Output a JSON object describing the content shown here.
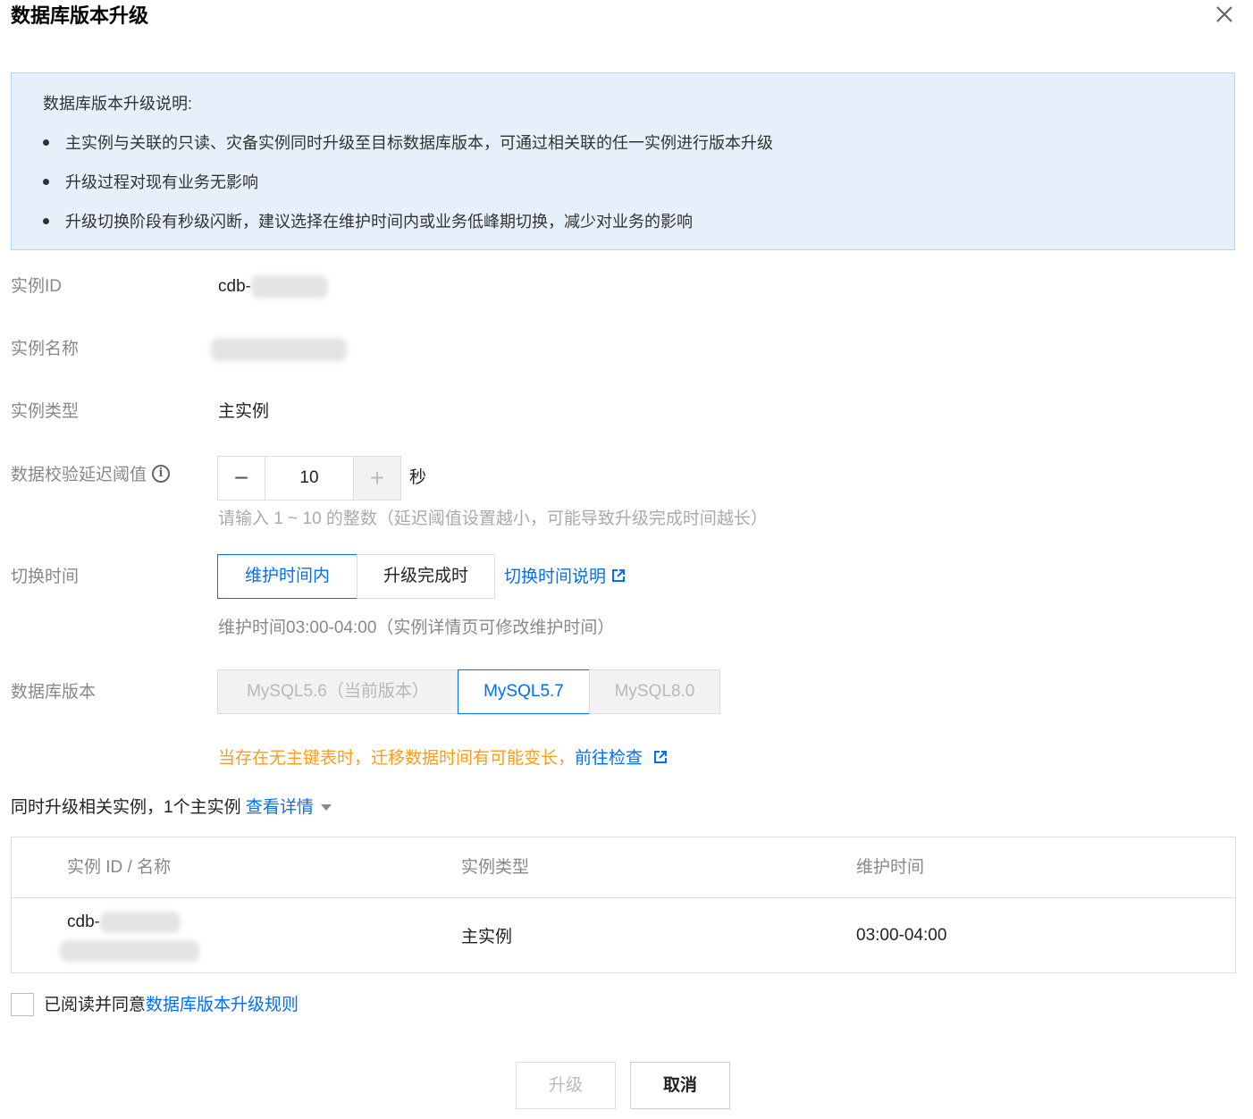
{
  "dialog": {
    "title": "数据库版本升级",
    "close_icon": "close-icon"
  },
  "notice": {
    "title": "数据库版本升级说明:",
    "items": [
      "主实例与关联的只读、灾备实例同时升级至目标数据库版本，可通过相关联的任一实例进行版本升级",
      "升级过程对现有业务无影响",
      "升级切换阶段有秒级闪断，建议选择在维护时间内或业务低峰期切换，减少对业务的影响"
    ]
  },
  "form": {
    "instance_id": {
      "label": "实例ID",
      "value_prefix": "cdb-"
    },
    "instance_name": {
      "label": "实例名称"
    },
    "instance_type": {
      "label": "实例类型",
      "value": "主实例"
    },
    "delay_threshold": {
      "label": "数据校验延迟阈值",
      "info_icon": "info-icon",
      "value": "10",
      "unit": "秒",
      "minus_icon": "minus-icon",
      "plus_icon": "plus-icon",
      "hint": "请输入 1 ~ 10 的整数（延迟阈值设置越小，可能导致升级完成时间越长）"
    },
    "switch_time": {
      "label": "切换时间",
      "options": [
        "维护时间内",
        "升级完成时"
      ],
      "selected": "维护时间内",
      "help_link": "切换时间说明",
      "hint": "维护时间03:00-04:00（实例详情页可修改维护时间）"
    },
    "db_version": {
      "label": "数据库版本",
      "options": [
        "MySQL5.6（当前版本）",
        "MySQL5.7",
        "MySQL8.0"
      ],
      "selected": "MySQL5.7"
    },
    "warning": {
      "text": "当存在无主键表时，迁移数据时间有可能变长，",
      "link": "前往检查"
    }
  },
  "related": {
    "text": "同时升级相关实例，1个主实例 ",
    "link": "查看详情",
    "table": {
      "headers": [
        "实例 ID / 名称",
        "实例类型",
        "维护时间"
      ],
      "rows": [
        {
          "id_prefix": "cdb-",
          "type": "主实例",
          "maintenance": "03:00-04:00"
        }
      ]
    }
  },
  "agreement": {
    "text": "已阅读并同意",
    "link": "数据库版本升级规则"
  },
  "footer": {
    "upgrade_label": "升级",
    "cancel_label": "取消"
  },
  "colors": {
    "accent": "#006eff",
    "warning": "#ff9c19",
    "notice_bg": "#e5f0fb"
  }
}
